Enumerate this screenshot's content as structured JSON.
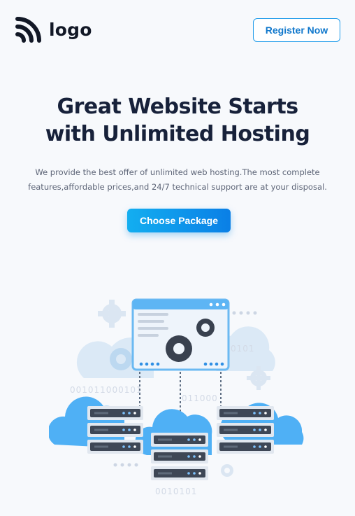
{
  "header": {
    "logo_text": "logo",
    "register_label": "Register Now"
  },
  "hero": {
    "title_line1": "Great Website Starts",
    "title_line2": "with Unlimited Hosting",
    "description": "We provide the best offer of unlimited web hosting.The most complete features,affordable prices,and 24/7 technical support are at your disposal.",
    "cta_label": "Choose Package"
  },
  "illustration": {
    "binary_1": "0101",
    "binary_2": "001011000101",
    "binary_3": "011000",
    "binary_4": "0010101"
  },
  "colors": {
    "accent": "#1e9bea",
    "cta_start": "#13aef0",
    "cta_end": "#0a7fe6",
    "cloud": "#4fb0f5",
    "server_dark": "#3e4756",
    "background": "#f7f9fc"
  },
  "icons": [
    "rss-logo-icon",
    "gear-icon",
    "server-icon",
    "cloud-icon",
    "browser-window-icon"
  ]
}
